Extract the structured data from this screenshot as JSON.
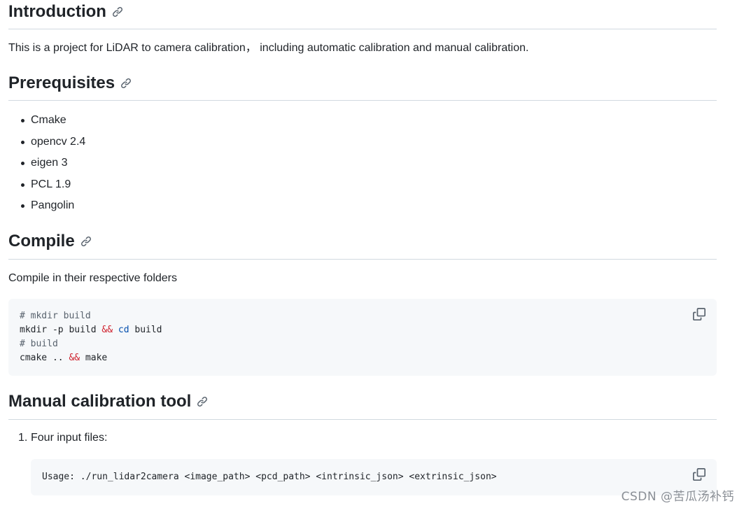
{
  "sections": {
    "introduction": {
      "heading": "Introduction",
      "body": "This is a project for LiDAR to camera calibration， including automatic calibration and manual calibration."
    },
    "prerequisites": {
      "heading": "Prerequisites",
      "items": [
        "Cmake",
        "opencv 2.4",
        "eigen 3",
        "PCL 1.9",
        "Pangolin"
      ]
    },
    "compile": {
      "heading": "Compile",
      "body": "Compile in their respective folders",
      "code": {
        "line1_comment": "# mkdir build",
        "line2_cmd1": "mkdir -p build ",
        "line2_op": "&&",
        "line2_space": " ",
        "line2_builtin": "cd",
        "line2_rest": " build",
        "line3_comment": "# build",
        "line4_cmd1": "cmake .. ",
        "line4_op": "&&",
        "line4_rest": " make"
      }
    },
    "manual": {
      "heading": "Manual calibration tool",
      "list_number": "1.",
      "list_text": "Four input files:",
      "code_line": "Usage: ./run_lidar2camera <image_path> <pcd_path> <intrinsic_json> <extrinsic_json>"
    }
  },
  "icons": {
    "anchor": "link-icon",
    "copy": "copy-icon"
  },
  "colors": {
    "text": "#1f2328",
    "muted": "#59636e",
    "rule": "#d1d9e0",
    "code_bg": "#f6f8fa",
    "code_operator": "#cf222e",
    "code_builtin": "#0550ae"
  },
  "watermark": "CSDN @苦瓜汤补钙"
}
